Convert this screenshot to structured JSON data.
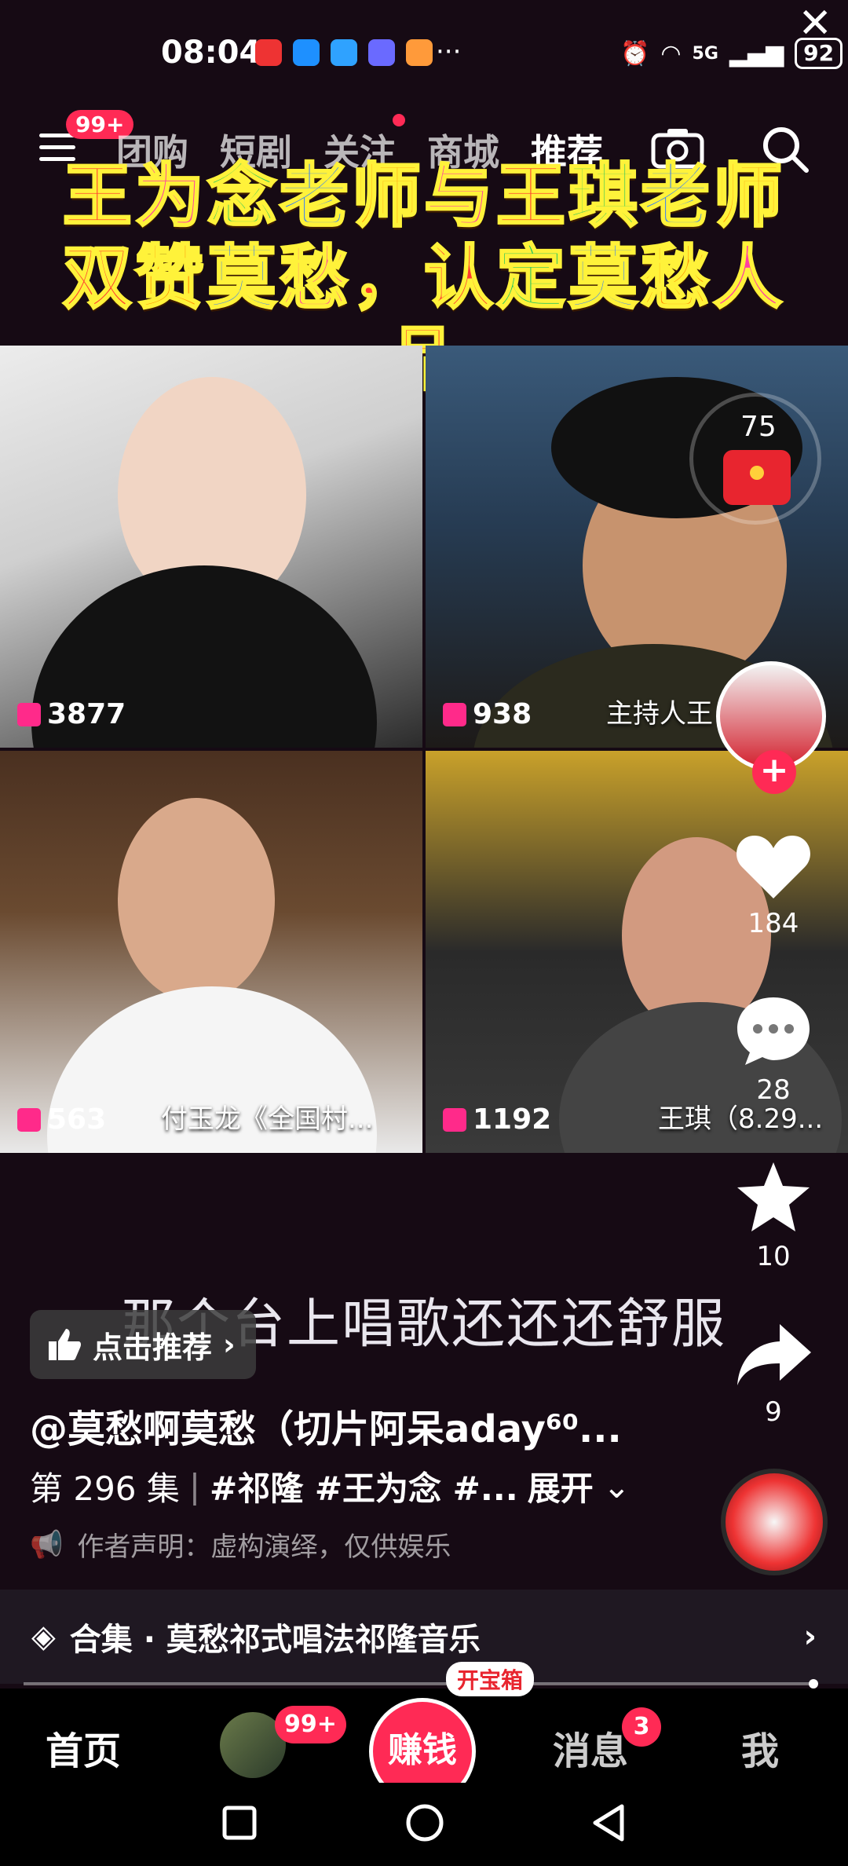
{
  "status_bar": {
    "time": "08:04",
    "network": "5G",
    "battery": "92",
    "more": "···"
  },
  "top_nav": {
    "menu_badge": "99+",
    "tabs": [
      "团购",
      "短剧",
      "关注",
      "商城",
      "推荐"
    ],
    "active_tab_index": 4
  },
  "video_title": {
    "line1": [
      {
        "text": "王",
        "color": "#ff3b2f"
      },
      {
        "text": "为",
        "color": "#ff3fa3"
      },
      {
        "text": "念",
        "color": "#22c55e"
      },
      {
        "text": "老",
        "color": "#2f7bff"
      },
      {
        "text": "师",
        "color": "#ff8a00"
      },
      {
        "text": "与",
        "color": "#ff3fa3"
      },
      {
        "text": "王",
        "color": "#ff3b2f"
      },
      {
        "text": "琪",
        "color": "#22c55e"
      },
      {
        "text": "老",
        "color": "#2f7bff"
      },
      {
        "text": "师",
        "color": "#ff8a00"
      }
    ],
    "line2": [
      {
        "text": "双",
        "color": "#ff3b2f"
      },
      {
        "text": "赞",
        "color": "#ff8a00"
      },
      {
        "text": "莫",
        "color": "#2f7bff"
      },
      {
        "text": "愁",
        "color": "#ff3fa3"
      },
      {
        "text": "，",
        "color": "#ff3b2f"
      },
      {
        "text": "认",
        "color": "#ff3b2f"
      },
      {
        "text": "定",
        "color": "#22c55e"
      },
      {
        "text": "莫",
        "color": "#2f7bff"
      },
      {
        "text": "愁",
        "color": "#ff8a00"
      },
      {
        "text": "人",
        "color": "#ff3fa3"
      },
      {
        "text": "品",
        "color": "#ff3b2f"
      }
    ]
  },
  "video_grid": [
    {
      "count": "3877",
      "name": ""
    },
    {
      "count": "938",
      "name": "主持人王"
    },
    {
      "count": "563",
      "name": "付玉龙《全国村..."
    },
    {
      "count": "1192",
      "name": "王琪（8.29..."
    }
  ],
  "red_envelope": {
    "count": "75"
  },
  "rail": {
    "likes": "184",
    "comments": "28",
    "favorites": "10",
    "shares": "9"
  },
  "subtitle": "那个台上唱歌还还还舒服",
  "recommend_pill": "点击推荐",
  "author_handle": "@莫愁啊莫愁（切片阿呆aday⁶⁰...",
  "episode": {
    "label": "第 296 集",
    "tags": "#祁隆 #王为念 #...",
    "expand": "展开"
  },
  "disclaimer": "作者声明：虚构演绎，仅供娱乐",
  "collection": "合集 · 莫愁祁式唱法祁隆音乐",
  "bottom_nav": {
    "home": "首页",
    "friends_badge": "99+",
    "earn": "赚钱",
    "treasure": "开宝箱",
    "messages": "消息",
    "messages_badge": "3",
    "me": "我"
  },
  "colors": {
    "accent": "#ff2a55",
    "background": "#160a14"
  }
}
